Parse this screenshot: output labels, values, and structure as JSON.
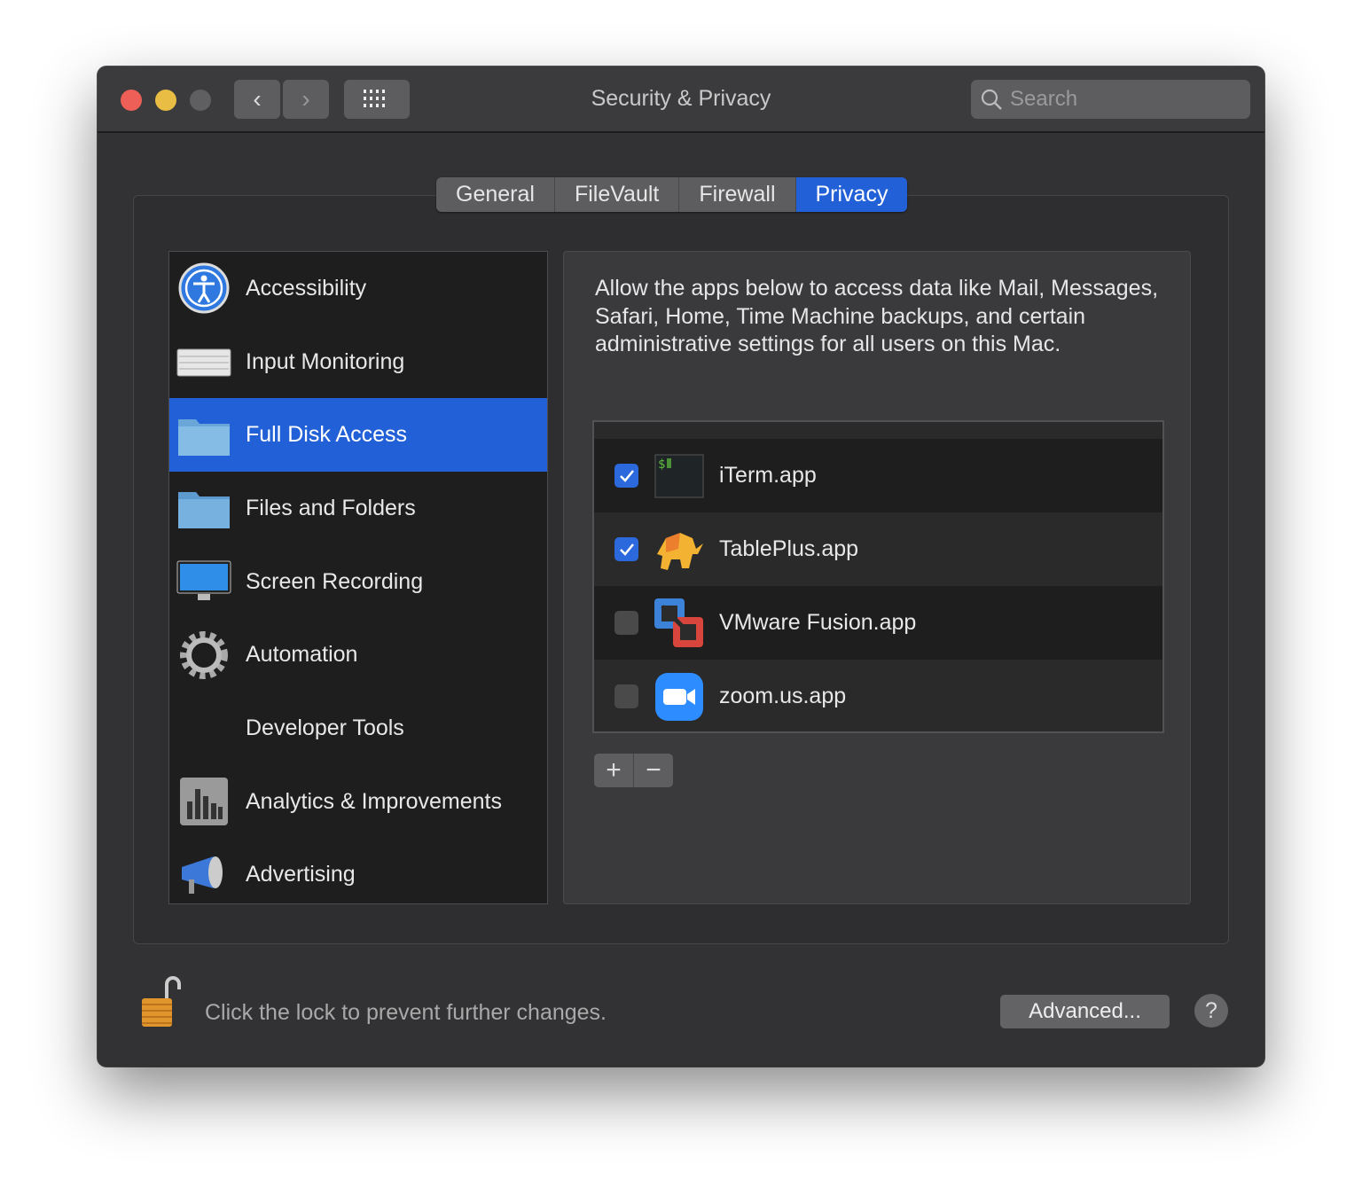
{
  "window": {
    "title": "Security & Privacy",
    "search_placeholder": "Search",
    "back": "‹",
    "forward": "›"
  },
  "tabs": [
    {
      "label": "General"
    },
    {
      "label": "FileVault"
    },
    {
      "label": "Firewall"
    },
    {
      "label": "Privacy",
      "active": true
    }
  ],
  "categories": [
    {
      "label": "Accessibility",
      "icon": "accessibility-icon"
    },
    {
      "label": "Input Monitoring",
      "icon": "keyboard-icon"
    },
    {
      "label": "Full Disk Access",
      "icon": "folder-icon",
      "selected": true
    },
    {
      "label": "Files and Folders",
      "icon": "folder-icon"
    },
    {
      "label": "Screen Recording",
      "icon": "display-icon"
    },
    {
      "label": "Automation",
      "icon": "gear-icon"
    },
    {
      "label": "Developer Tools",
      "icon": "none"
    },
    {
      "label": "Analytics & Improvements",
      "icon": "bar-chart-icon"
    },
    {
      "label": "Advertising",
      "icon": "megaphone-icon"
    }
  ],
  "panel": {
    "description": "Allow the apps below to access data like Mail, Messages, Safari, Home, Time Machine backups, and certain administrative settings for all users on this Mac.",
    "apps": [
      {
        "name": "iTerm.app",
        "checked": true
      },
      {
        "name": "TablePlus.app",
        "checked": true
      },
      {
        "name": "VMware Fusion.app",
        "checked": false
      },
      {
        "name": "zoom.us.app",
        "checked": false
      }
    ],
    "add_label": "+",
    "remove_label": "−"
  },
  "footer": {
    "lock_text": "Click the lock to prevent further changes.",
    "advanced_label": "Advanced...",
    "help_label": "?"
  },
  "colors": {
    "accent": "#2160d6",
    "close": "#ed5f57",
    "minimize": "#e9bd43",
    "zoom_disabled": "#5f5f61"
  }
}
